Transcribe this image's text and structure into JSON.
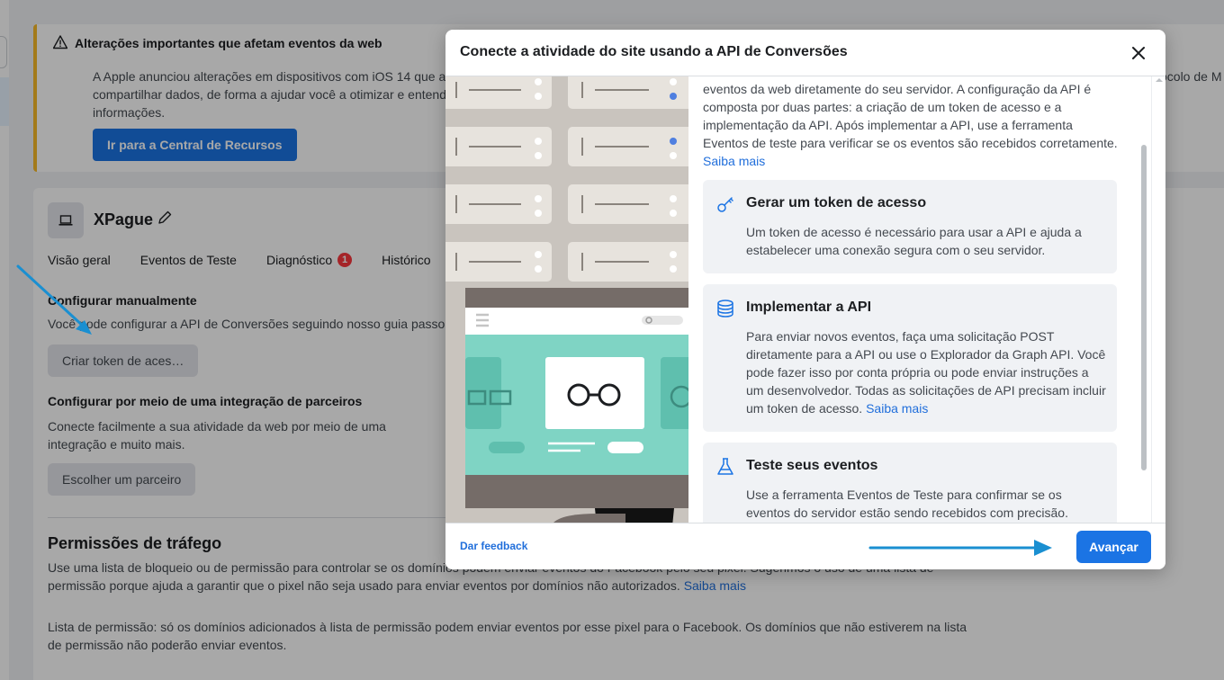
{
  "background": {
    "banner": {
      "title": "Alterações importantes que afetam eventos da web",
      "text_left": "A Apple anunciou alterações em dispositivos com iOS 14 que a compartilhar dados, de forma a ajudar você a otimizar e entend informações.",
      "text_right": "ocolo de M domínios,",
      "button": "Ir para a Central de Recursos"
    },
    "pixel": {
      "name": "XPague",
      "tabs": [
        {
          "label": "Visão geral"
        },
        {
          "label": "Eventos de Teste"
        },
        {
          "label": "Diagnóstico",
          "badge": "1"
        },
        {
          "label": "Histórico"
        }
      ]
    },
    "manual": {
      "title": "Configurar manualmente",
      "text": "Você pode configurar a API de Conversões seguindo nosso guia passo",
      "button": "Criar token de aces…"
    },
    "partner": {
      "title": "Configurar por meio de uma integração de parceiros",
      "text": "Conecte facilmente a sua atividade da web por meio de uma integração e muito mais.",
      "button": "Escolher um parceiro"
    },
    "traffic": {
      "title": "Permissões de tráfego",
      "text": "Use uma lista de bloqueio ou de permissão para controlar se os domínios podem enviar eventos do Facebook pelo seu pixel. Sugerimos o uso de uma lista de permissão porque ajuda a garantir que o pixel não seja usado para enviar eventos por domínios não autorizados.",
      "link": "Saiba mais",
      "allowlist_text": "Lista de permissão: só os domínios adicionados à lista de permissão podem enviar eventos por esse pixel para o Facebook. Os domínios que não estiverem na lista de permissão não poderão enviar eventos."
    }
  },
  "modal": {
    "title": "Conecte a atividade do site usando a API de Conversões",
    "intro": "eventos da web diretamente do seu servidor. A configuração da API é composta por duas partes: a criação de um token de acesso e a implementação da API. Após implementar a API, use a ferramenta Eventos de teste para verificar se os eventos são recebidos corretamente.",
    "intro_link": "Saiba mais",
    "cards": [
      {
        "icon": "key-icon",
        "title": "Gerar um token de acesso",
        "text": "Um token de acesso é necessário para usar a API e ajuda a estabelecer uma conexão segura com o seu servidor."
      },
      {
        "icon": "database-icon",
        "title": "Implementar a API",
        "text": "Para enviar novos eventos, faça uma solicitação POST diretamente para a API ou use o Explorador da Graph API. Você pode fazer isso por conta própria ou pode enviar instruções a um desenvolvedor. Todas as solicitações de API precisam incluir um token de acesso.",
        "link": "Saiba mais"
      },
      {
        "icon": "flask-icon",
        "title": "Teste seus eventos",
        "text": "Use a ferramenta Eventos de Teste para confirmar se os eventos do servidor estão sendo recebidos com precisão."
      }
    ],
    "feedback": "Dar feedback",
    "next_button": "Avançar"
  }
}
